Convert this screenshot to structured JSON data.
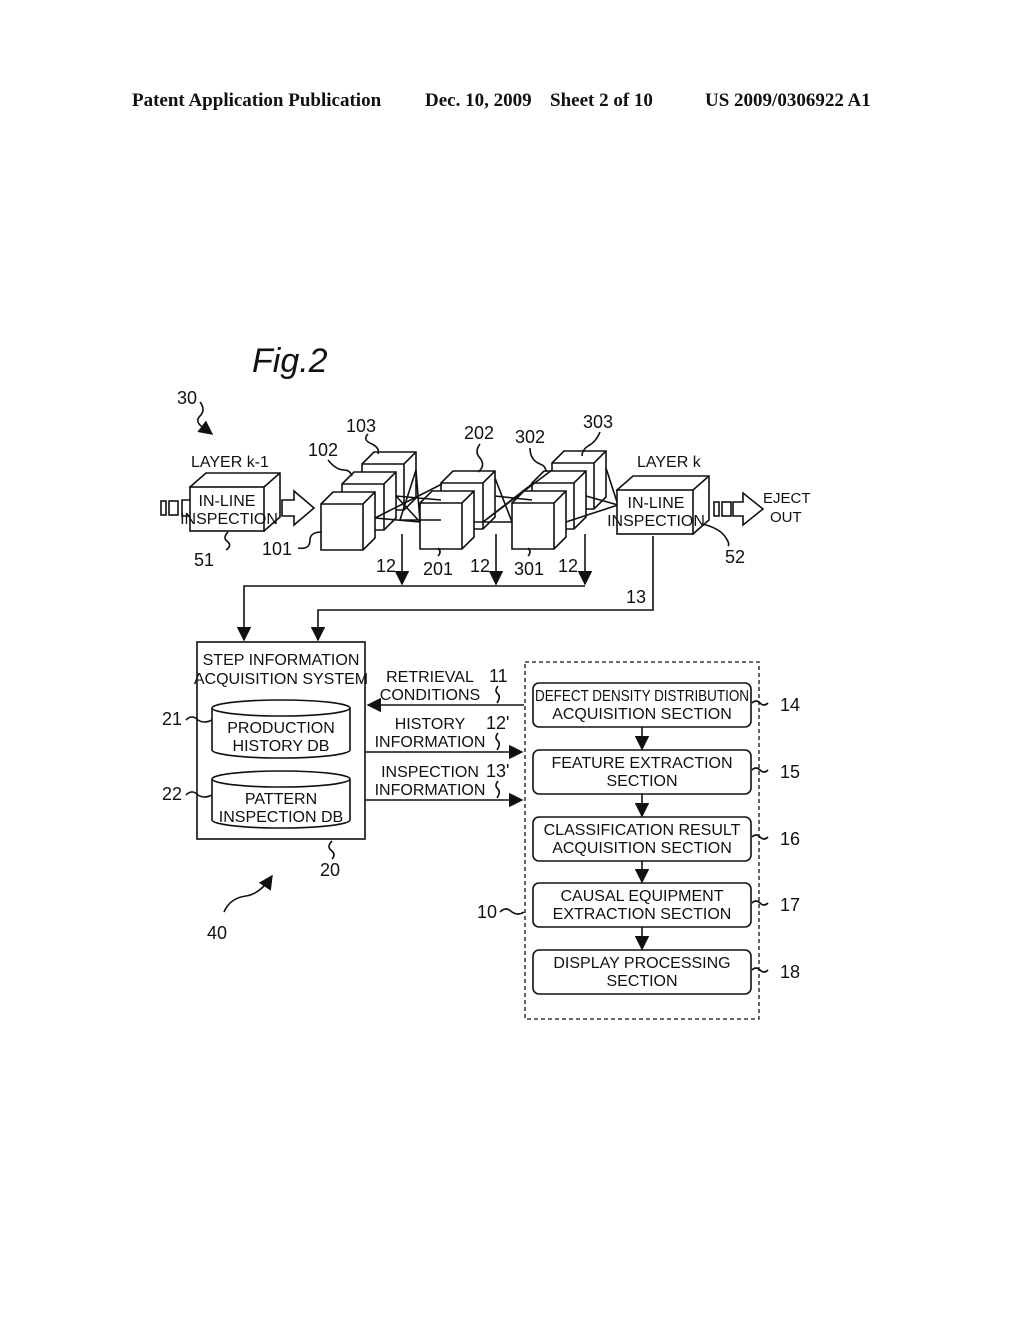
{
  "header": {
    "publication": "Patent Application Publication",
    "date": "Dec. 10, 2009",
    "sheet": "Sheet 2 of 10",
    "number": "US 2009/0306922 A1"
  },
  "figure": {
    "title": "Fig.2",
    "ref_30": "30",
    "ref_40": "40",
    "line": {
      "layer_prev": "LAYER  k-1",
      "layer_next": "LAYER  k",
      "inspection_prev": [
        "IN-LINE",
        "INSPECTION"
      ],
      "inspection_next": [
        "IN-LINE",
        "INSPECTION"
      ],
      "ref_51": "51",
      "ref_52": "52",
      "eject": [
        "EJECT",
        "OUT"
      ],
      "equipment": [
        "101",
        "102",
        "103",
        "201",
        "202",
        "301",
        "302",
        "303"
      ],
      "ref_12": "12",
      "ref_13": "13"
    },
    "step_system": {
      "title": [
        "STEP  INFORMATION",
        "ACQUISITION  SYSTEM"
      ],
      "ref": "20",
      "db1": [
        "PRODUCTION",
        "HISTORY  DB"
      ],
      "db1_ref": "21",
      "db2": [
        "PATTERN",
        "INSPECTION  DB"
      ],
      "db2_ref": "22"
    },
    "signals": [
      {
        "label": [
          "RETRIEVAL",
          "CONDITIONS"
        ],
        "ref": "11"
      },
      {
        "label": [
          "HISTORY",
          "INFORMATION"
        ],
        "ref": "12'"
      },
      {
        "label": [
          "INSPECTION",
          "INFORMATION"
        ],
        "ref": "13'"
      }
    ],
    "analyzer": {
      "ref": "10",
      "sections": [
        {
          "label": [
            "DEFECT  DENSITY  DISTRIBUTION",
            "ACQUISITION  SECTION"
          ],
          "ref": "14"
        },
        {
          "label": [
            "FEATURE  EXTRACTION",
            "SECTION"
          ],
          "ref": "15"
        },
        {
          "label": [
            "CLASSIFICATION  RESULT",
            "ACQUISITION  SECTION"
          ],
          "ref": "16"
        },
        {
          "label": [
            "CAUSAL  EQUIPMENT",
            "EXTRACTION  SECTION"
          ],
          "ref": "17"
        },
        {
          "label": [
            "DISPLAY  PROCESSING",
            "SECTION"
          ],
          "ref": "18"
        }
      ]
    }
  }
}
